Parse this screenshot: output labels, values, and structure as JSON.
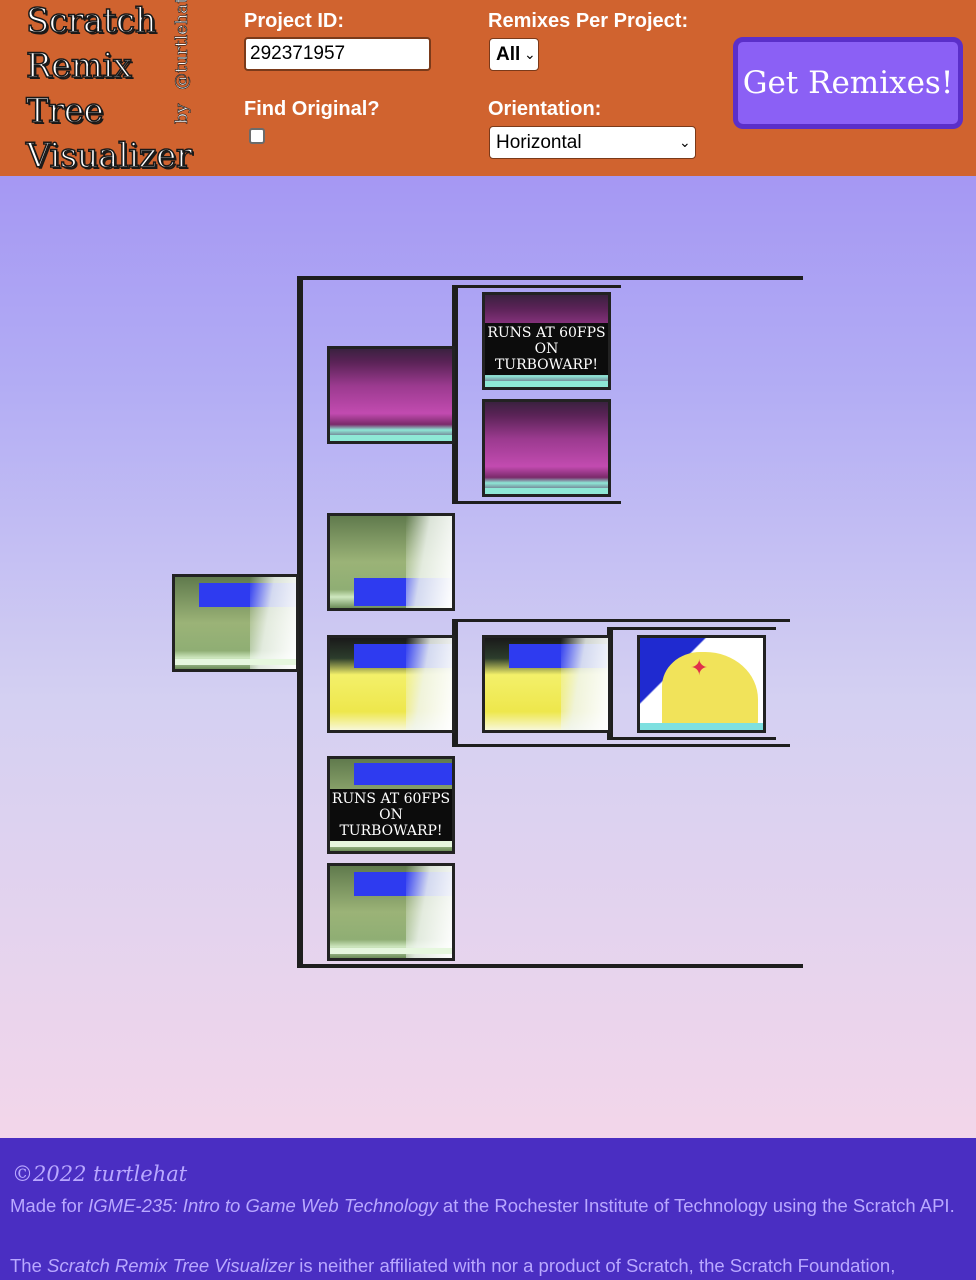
{
  "header": {
    "logo_lines": [
      "Scratch",
      "Remix",
      "Tree",
      "Visualizer"
    ],
    "byline_by": "by",
    "byline_name": "@turtlehat",
    "project_id_label": "Project ID:",
    "project_id_value": "292371957",
    "find_original_label": "Find Original?",
    "find_original_checked": false,
    "remixes_label": "Remixes Per Project:",
    "remixes_value": "All",
    "orientation_label": "Orientation:",
    "orientation_value": "Horizontal",
    "go_button": "Get Remixes!",
    "colors": {
      "header_bg": "#d0632f",
      "button_bg": "#8b60f5",
      "button_border": "#5b2fc9"
    }
  },
  "tree": {
    "root": {
      "thumb": "field-with-blue-instructions"
    },
    "children": [
      {
        "thumb": "stage-concert",
        "children": [
          {
            "thumb": "stage-concert",
            "caption": "RUNS AT 60FPS ON TURBOWARP!"
          },
          {
            "thumb": "stage-concert"
          }
        ]
      },
      {
        "thumb": "field-with-blue-instructions"
      },
      {
        "thumb": "yellow-floor",
        "children": [
          {
            "thumb": "yellow-floor",
            "children": [
              {
                "thumb": "yellow-dog-cartoon"
              }
            ]
          }
        ]
      },
      {
        "thumb": "field-with-blue-instructions",
        "caption": "RUNS AT 60FPS ON TURBOWARP!"
      },
      {
        "thumb": "field-with-blue-instructions"
      }
    ]
  },
  "footer": {
    "copyright": "©2022 turtlehat",
    "made_for_pre": "Made for ",
    "course": "IGME-235: Intro to Game Web Technology",
    "made_for_post": " at the Rochester Institute of Technology using the Scratch API.",
    "disclaimer_pre": "The ",
    "disclaimer_title": "Scratch Remix Tree Visualizer",
    "disclaimer_post": " is neither affiliated with nor a product of Scratch, the Scratch Foundation,",
    "colors": {
      "footer_bg": "#4a2ec2",
      "footer_text": "#b9a8ff"
    }
  }
}
